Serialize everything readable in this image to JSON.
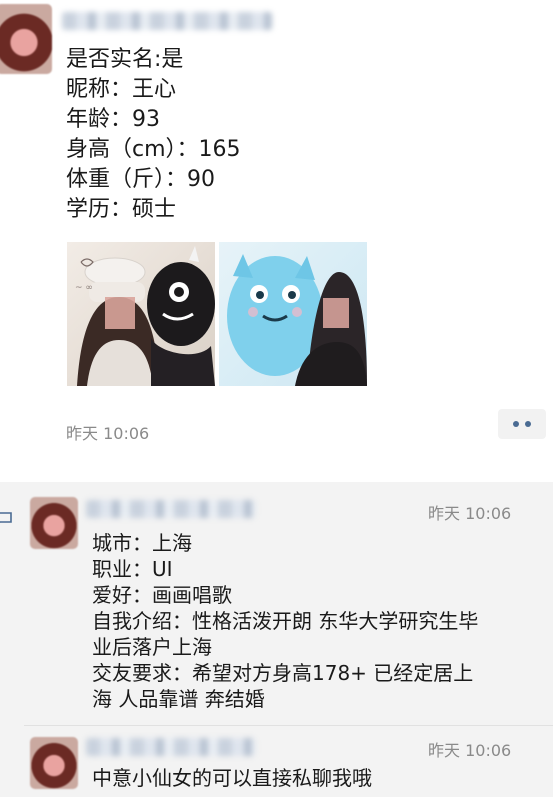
{
  "post": {
    "lines": [
      "是否实名:是",
      "昵称：王心",
      "年龄：93",
      "身高（cm）：165",
      "体重（斤）：90",
      "学历：硕士"
    ],
    "time": "昨天 10:06"
  },
  "comments": [
    {
      "time": "昨天 10:06",
      "lines": [
        "城市：上海",
        "职业：UI",
        "爱好：画画唱歌",
        "自我介绍：性格活泼开朗 东华大学研究生毕",
        "业后落户上海",
        "交友要求：希望对方身高178+ 已经定居上",
        "海 人品靠谱 奔结婚"
      ]
    },
    {
      "time": "昨天 10:06",
      "lines": [
        "中意小仙女的可以直接私聊我哦"
      ]
    }
  ],
  "icons": {
    "more": "more-icon",
    "comment": "comment-icon"
  },
  "colors": {
    "link_blue": "#4a6b93",
    "comment_bg": "#f3f3f3",
    "time_gray": "#8a8a8a"
  }
}
